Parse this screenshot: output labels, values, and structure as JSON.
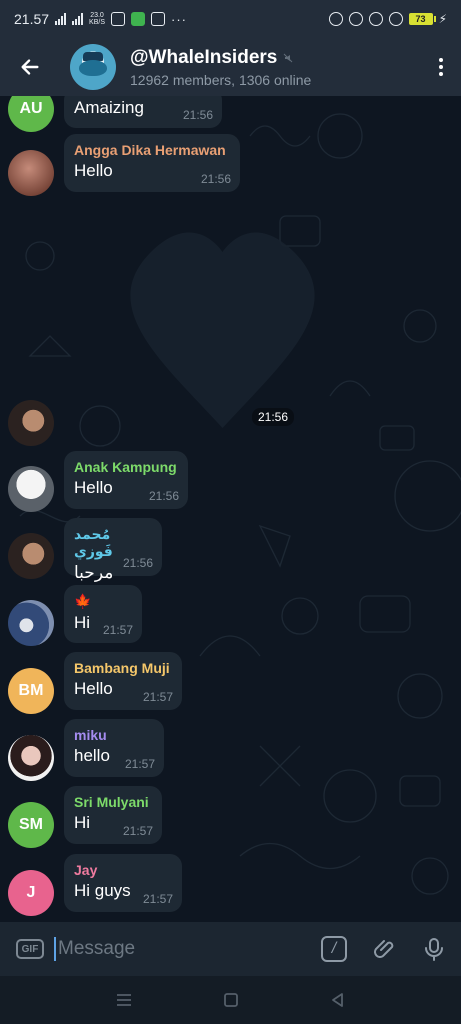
{
  "status_bar": {
    "time": "21.57",
    "network_speed": "23.0",
    "network_unit": "KB/S",
    "battery": "73"
  },
  "header": {
    "title": "@WhaleInsiders",
    "subtitle": "12962 members, 1306 online"
  },
  "messages": [
    {
      "id": "au",
      "avatar_initials": "AU",
      "avatar_color": "#5fb84a",
      "sender": "",
      "text": "Amaizing",
      "time": "21:56"
    },
    {
      "id": "angga",
      "sender": "Angga Dika Hermawan",
      "sender_color": "#e9a074",
      "text": "Hello",
      "time": "21:56"
    },
    {
      "id": "sticker",
      "time": "21:56"
    },
    {
      "id": "anak",
      "sender": "Anak Kampung",
      "sender_color": "#7ddb6a",
      "text": "Hello",
      "time": "21:56"
    },
    {
      "id": "muhammad",
      "sender": "مُحمد فَوزي",
      "sender_color": "#5fc8e8",
      "text": "مرحبا",
      "time": "21:56"
    },
    {
      "id": "leaf",
      "sender": "🍁",
      "sender_color": "#ff8c2b",
      "text": "Hi",
      "time": "21:57"
    },
    {
      "id": "bambang",
      "avatar_initials": "BM",
      "avatar_color": "#f0b55a",
      "sender": "Bambang Muji",
      "sender_color": "#f5c76a",
      "text": "Hello",
      "time": "21:57"
    },
    {
      "id": "miku",
      "sender": "miku",
      "sender_color": "#a58cf0",
      "text": "hello",
      "time": "21:57"
    },
    {
      "id": "sri",
      "avatar_initials": "SM",
      "avatar_color": "#5fb84a",
      "sender": "Sri Mulyani",
      "sender_color": "#7ddb6a",
      "text": "Hi",
      "time": "21:57"
    },
    {
      "id": "jay",
      "avatar_initials": "J",
      "avatar_color": "#e8638e",
      "sender": "Jay",
      "sender_color": "#f07b9f",
      "text": "Hi guys",
      "time": "21:57"
    }
  ],
  "composer": {
    "gif_label": "GIF",
    "placeholder": "Message",
    "command_label": "/"
  },
  "colors": {
    "header_bg": "#232d3a",
    "chat_bg": "#0e1621",
    "bubble_bg": "#1e2934",
    "accent": "#5ea3e6"
  }
}
